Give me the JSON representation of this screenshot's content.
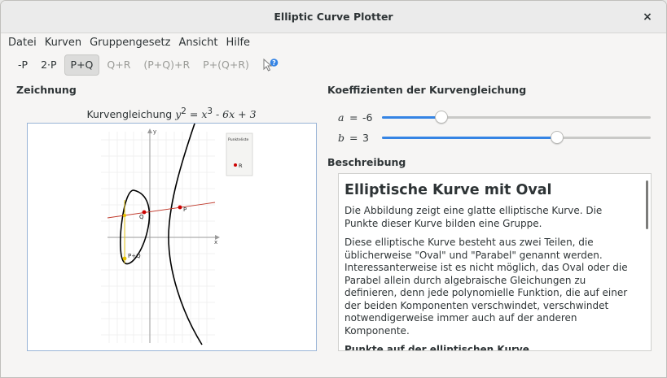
{
  "window": {
    "title": "Elliptic Curve Plotter",
    "close_glyph": "×"
  },
  "menu": [
    "Datei",
    "Kurven",
    "Gruppengesetz",
    "Ansicht",
    "Hilfe"
  ],
  "toolbar": [
    {
      "label": "-P",
      "state": "normal"
    },
    {
      "label": "2·P",
      "state": "normal"
    },
    {
      "label": "P+Q",
      "state": "active"
    },
    {
      "label": "Q+R",
      "state": "disabled"
    },
    {
      "label": "(P+Q)+R",
      "state": "disabled"
    },
    {
      "label": "P+(Q+R)",
      "state": "disabled"
    }
  ],
  "toolbar_help_icon": "whats-this-help-icon",
  "drawing": {
    "heading": "Zeichnung",
    "formula_prefix": "Kurvengleichung ",
    "formula": {
      "y": "y",
      "exp2": "2",
      "eq": " = ",
      "x": "x",
      "exp3": "3",
      "rest": " - 6x + 3"
    },
    "axis_x_label": "x",
    "axis_y_label": "y",
    "legend_title": "Punkteliste",
    "legend_point": "R",
    "points": [
      {
        "label": "P",
        "color": "#cc0000"
      },
      {
        "label": "Q",
        "color": "#cc0000"
      },
      {
        "label": "P+Q",
        "color": "#e6c200"
      }
    ]
  },
  "coefficients": {
    "heading": "Koeffizienten der Kurvengleichung",
    "a": {
      "name": "a",
      "eq": "=",
      "value": "-6",
      "fraction": 0.22
    },
    "b": {
      "name": "b",
      "eq": "=",
      "value": "3",
      "fraction": 0.65
    }
  },
  "description": {
    "heading": "Beschreibung",
    "title": "Elliptische Kurve mit Oval",
    "p1": "Die Abbildung zeigt eine glatte elliptische Kurve. Die Punkte dieser Kurve bilden eine Gruppe.",
    "p2": "Diese elliptische Kurve besteht aus zwei Teilen, die üblicherweise \"Oval\" und \"Parabel\" genannt werden. Interessanterweise ist es nicht möglich, das Oval oder die Parabel allein durch algebraische Gleichungen zu definieren, denn jede polynomielle Funktion, die auf einer der beiden Komponenten verschwindet, verschwindet notwendigerweise immer auch auf der anderen Komponente.",
    "subheading": "Punkte auf der elliptischen Kurve"
  },
  "colors": {
    "accent": "#3584e4",
    "curve": "#000000",
    "line": "#c0392b",
    "point": "#cc0000",
    "sum_point": "#e6c200"
  }
}
